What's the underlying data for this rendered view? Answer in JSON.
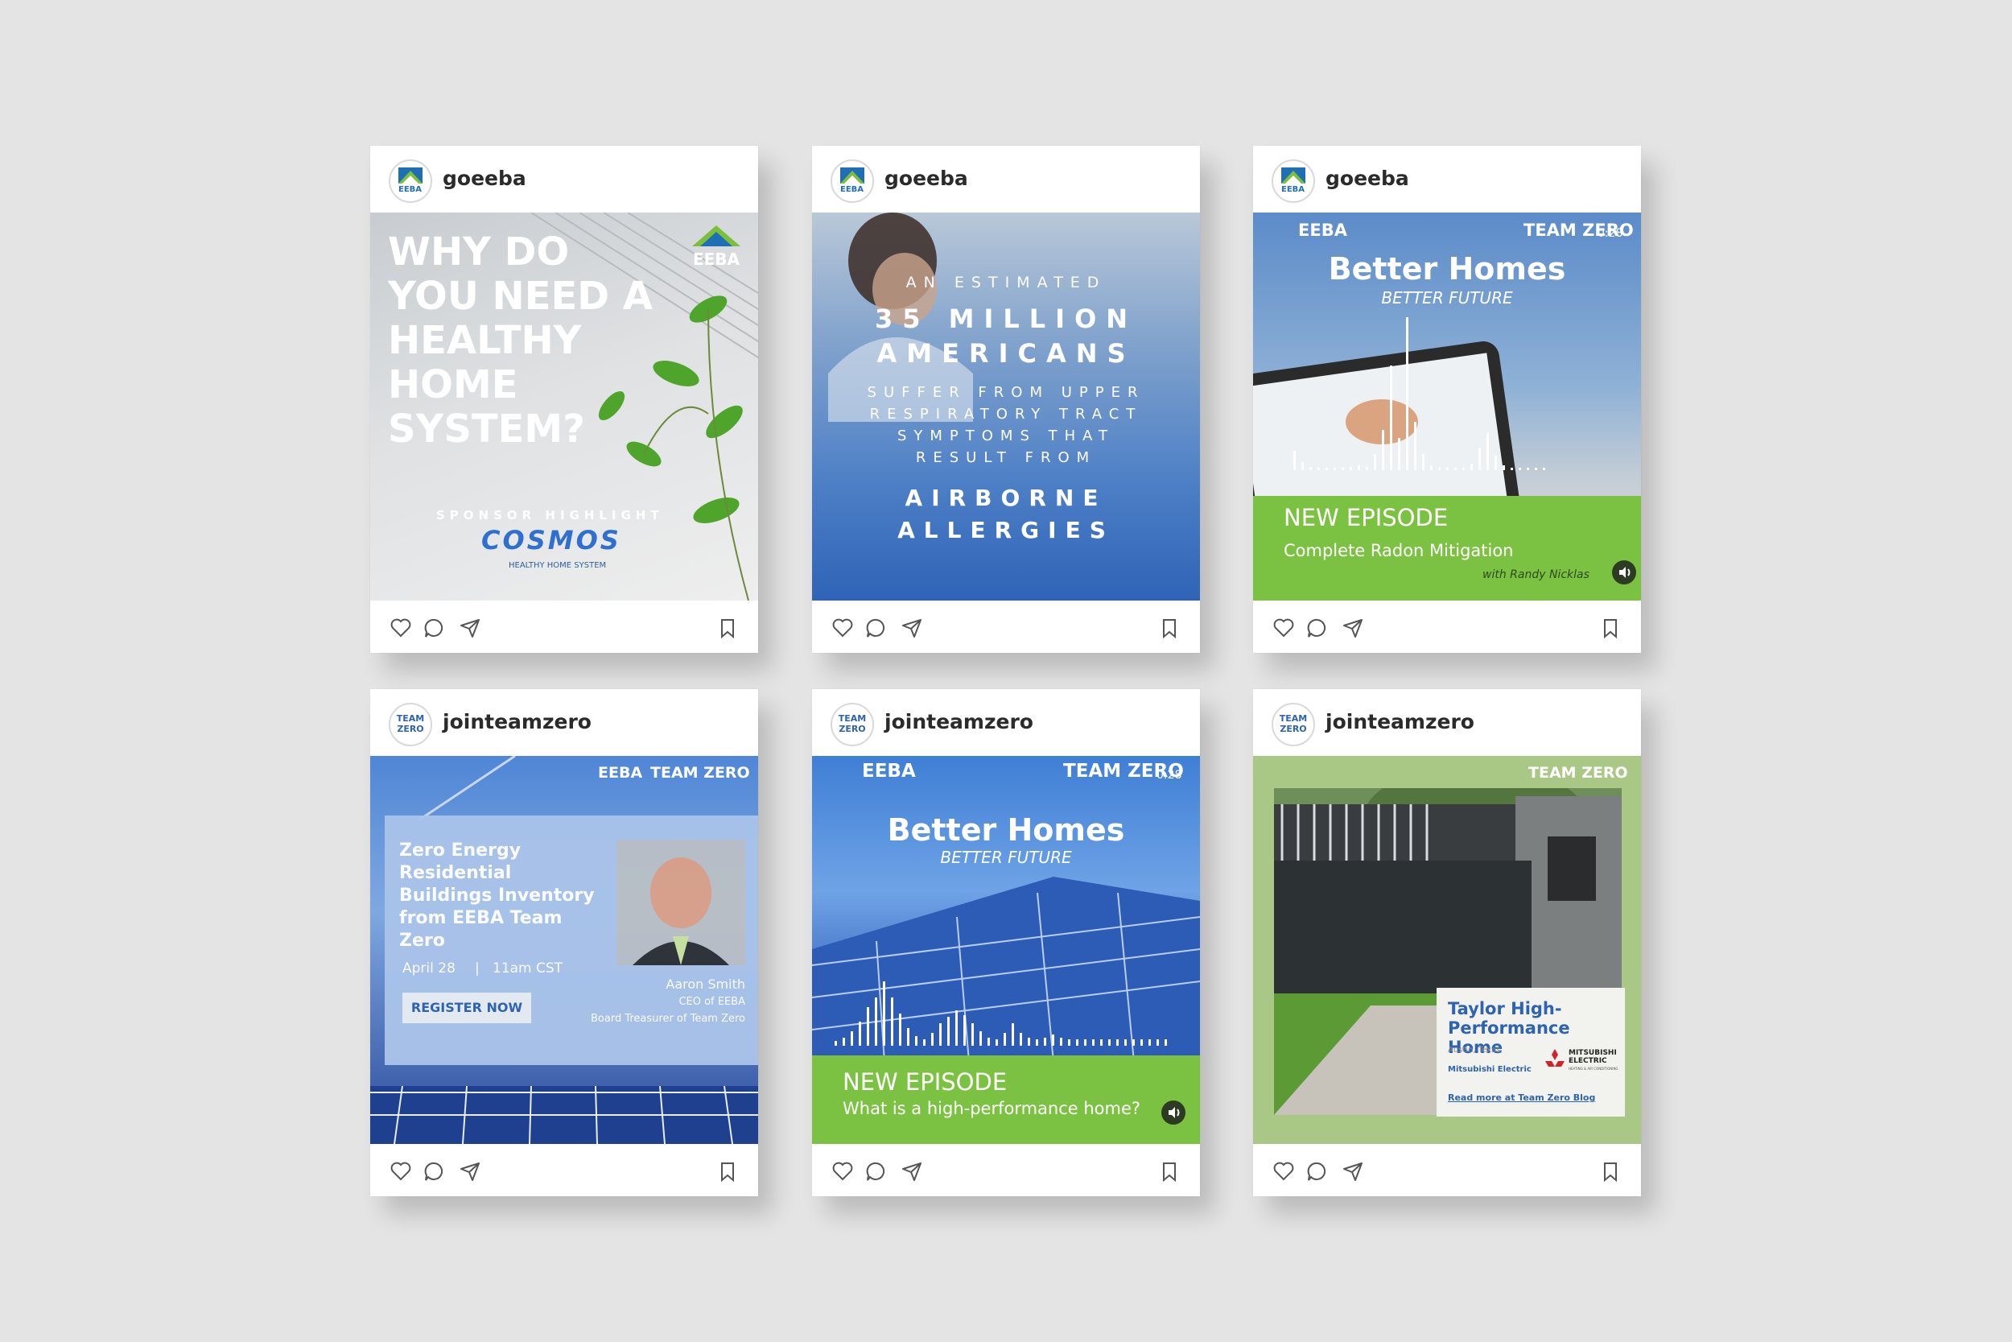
{
  "posts": [
    {
      "handle": "goeeba",
      "avatar_text": "EEBA",
      "headline": "WHY DO YOU NEED A HEALTHY HOME SYSTEM?",
      "logo_text": "EEBA",
      "sponsor_label": "SPONSOR HIGHLIGHT",
      "sponsor_brand": "COSMOS",
      "sponsor_tagline": "HEALTHY HOME SYSTEM"
    },
    {
      "handle": "goeeba",
      "avatar_text": "EEBA",
      "line1": "AN ESTIMATED",
      "line2": "35 MILLION",
      "line3": "AMERICANS",
      "line4": "SUFFER FROM UPPER",
      "line5": "RESPIRATORY TRACT",
      "line6": "SYMPTOMS THAT",
      "line7": "RESULT FROM",
      "line8": "AIRBORNE",
      "line9": "ALLERGIES"
    },
    {
      "handle": "goeeba",
      "avatar_text": "EEBA",
      "brand_left": "EEBA",
      "brand_right": "TEAM ZERO",
      "timer": "0:28",
      "title": "Better Homes",
      "subtitle": "BETTER FUTURE",
      "episode_label": "NEW EPISODE",
      "episode_title": "Complete Radon Mitigation",
      "episode_host": "with Randy Nicklas"
    },
    {
      "handle": "jointeamzero",
      "avatar_text": "TEAM ZERO",
      "brand_left": "EEBA",
      "brand_right": "TEAM ZERO",
      "title": "Zero Energy Residential Buildings Inventory from EEBA Team Zero",
      "date": "April 28",
      "time": "11am CST",
      "cta": "REGISTER NOW",
      "speaker_name": "Aaron Smith",
      "speaker_role1": "CEO of EEBA",
      "speaker_role2": "Board Treasurer of Team Zero"
    },
    {
      "handle": "jointeamzero",
      "avatar_text": "TEAM ZERO",
      "brand_left": "EEBA",
      "brand_right": "TEAM ZERO",
      "timer": "0:28",
      "title": "Better Homes",
      "subtitle": "BETTER FUTURE",
      "episode_label": "NEW EPISODE",
      "episode_title": "What is a high-performance home?"
    },
    {
      "handle": "jointeamzero",
      "avatar_text": "TEAM ZERO",
      "brand_right": "TEAM ZERO",
      "title": "Taylor High-Performance Home",
      "location": "Austin, Texas",
      "partner": "Mitsubishi Electric",
      "partner_logo": "MITSUBISHI ELECTRIC",
      "partner_logo_sub": "HEATING & AIR CONDITIONING",
      "link": "Read more at Team Zero Blog"
    }
  ],
  "colors": {
    "background": "#e4e4e4",
    "card": "#ffffff",
    "eeba_blue": "#1f6fb6",
    "eeba_green": "#7bbf3a",
    "episode_green": "#7cc242",
    "team_zero_blue": "#2d63b0"
  },
  "icons": [
    "heart-icon",
    "comment-icon",
    "share-icon",
    "bookmark-icon",
    "speaker-icon",
    "play-icon"
  ]
}
